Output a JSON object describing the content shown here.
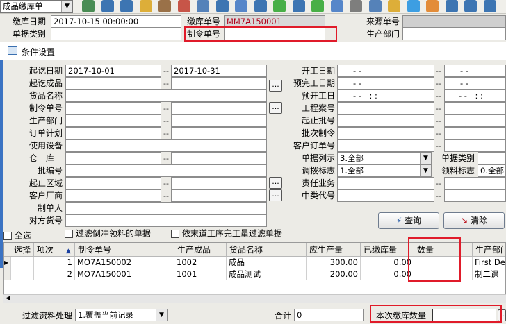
{
  "toolbar": {
    "doc_type_select": "成品缴库单",
    "icons": [
      "tree-icon",
      "grid-icon",
      "refresh-icon",
      "lock-icon",
      "briefcase-icon",
      "cursor-icon",
      "logo-icon",
      "key-icon",
      "mail-icon",
      "help-icon",
      "dollar-icon",
      "cart-icon",
      "money-icon",
      "undo-icon",
      "copy-icon",
      "report-icon",
      "bulb-icon",
      "check-icon",
      "image-icon",
      "network-icon",
      "close-icon",
      "disk-icon"
    ]
  },
  "header": {
    "date_label": "缴库日期",
    "date_value": "2017-10-15 00:00:00",
    "docno_label": "缴库单号",
    "docno_value": "MM7A150001",
    "source_label": "来源单号",
    "doctype_label": "单据类别",
    "order_label": "制令单号",
    "dept_label": "生产部门"
  },
  "dialog": {
    "title": "条件设置",
    "left": {
      "start_date_label": "起讫日期",
      "start_date_from": "2017-10-01",
      "start_date_to": "2017-10-31",
      "product_label": "起讫成品",
      "item_name_label": "货品名称",
      "order_label": "制令单号",
      "dept_label": "生产部门",
      "plan_label": "订单计划",
      "equipment_label": "使用设备",
      "warehouse_label": "仓　库",
      "batch_label": "批编号",
      "area_label": "起止区域",
      "customer_label": "客户厂商",
      "creator_label": "制单人",
      "vendor_label": "对方货号"
    },
    "right": {
      "start_label": "开工日期",
      "start_from": "- -",
      "start_to": "- -",
      "finish_label": "预完工日期",
      "finish_from": "- -",
      "finish_to": "- -",
      "prestart_label": "预开工日",
      "prestart_from": "- -　: :",
      "prestart_to": "- -　: :",
      "project_label": "工程案号",
      "batchno_label": "起止批号",
      "batchorder_label": "批次制令",
      "custorder_label": "客户订单号",
      "doclist_label": "单据列示",
      "doclist_value": "3.全部",
      "doccat_label": "单据类别",
      "transfer_label": "调拨标志",
      "transfer_value": "1.全部",
      "pick_label": "领料标志",
      "pick_value": "0.全部",
      "duty_label": "责任业务",
      "middle_label": "中类代号"
    },
    "checks": {
      "select_all": "全选",
      "filter_pick": "过滤倒冲领料的单据",
      "filter_proc": "依末道工序完工量过滤单据"
    },
    "buttons": {
      "query": "查询",
      "clear": "清除"
    },
    "grid": {
      "headers": [
        "选择",
        "项次",
        "制令单号",
        "生产成品",
        "货品名称",
        "应生产量",
        "已缴库量",
        "数量",
        "生产部门"
      ],
      "rows": [
        {
          "seq": "1",
          "order": "MO7A150002",
          "product": "1002",
          "name": "成品一",
          "planned": "300.00",
          "done": "0.00",
          "qty": "",
          "dept": "First Dep"
        },
        {
          "seq": "2",
          "order": "MO7A150001",
          "product": "1001",
          "name": "成品测试",
          "planned": "200.00",
          "done": "0.00",
          "qty": "",
          "dept": "制二课"
        }
      ]
    },
    "footer": {
      "filter_label": "过滤资料处理",
      "filter_value": "1.覆盖当前记录",
      "total_label": "合计",
      "total_value": "0",
      "current_qty_label": "本次缴库数量",
      "current_qty_value": ""
    }
  },
  "colors": {
    "highlight": "#e01b2a",
    "docno_text": "#b0001a",
    "chrome": "#ecebe6"
  }
}
